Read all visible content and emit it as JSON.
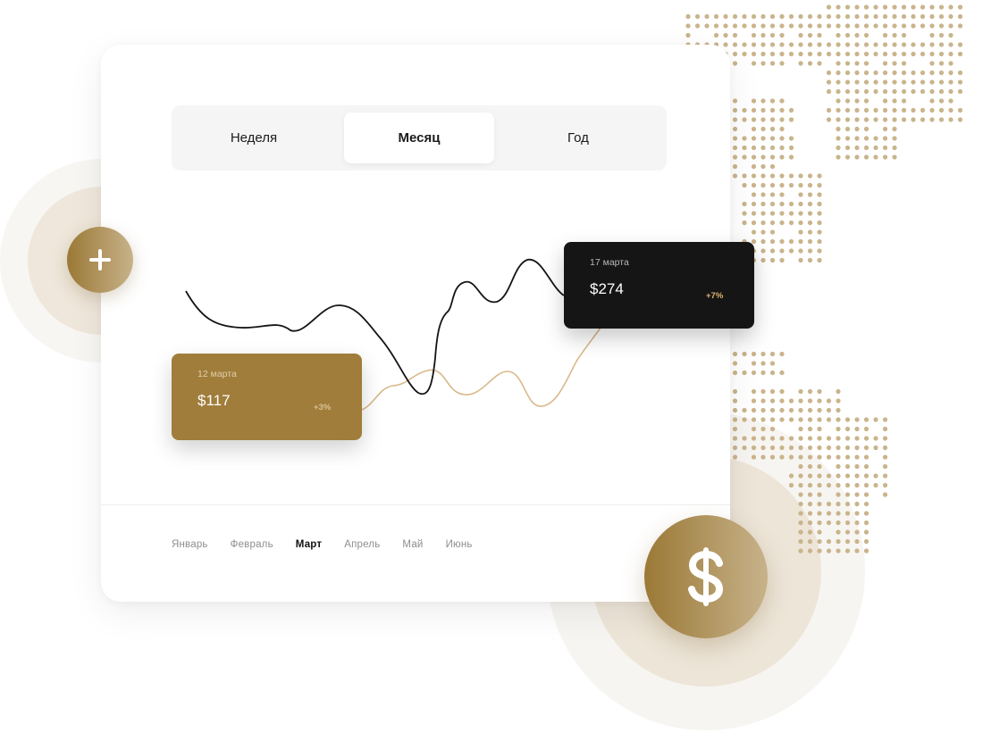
{
  "colors": {
    "gold": "#a07d3b",
    "gold_light": "#d9b98a",
    "dark": "#151515",
    "map_dots": "#c9b48c"
  },
  "period_tabs": [
    {
      "label": "Неделя",
      "active": false
    },
    {
      "label": "Месяц",
      "active": true
    },
    {
      "label": "Год",
      "active": false
    }
  ],
  "months": [
    {
      "label": "Январь",
      "active": false
    },
    {
      "label": "Февраль",
      "active": false
    },
    {
      "label": "Март",
      "active": true
    },
    {
      "label": "Апрель",
      "active": false
    },
    {
      "label": "Май",
      "active": false
    },
    {
      "label": "Июнь",
      "active": false
    }
  ],
  "tooltips": {
    "gold": {
      "date": "12 марта",
      "amount": "$117",
      "change": "+3%"
    },
    "dark": {
      "date": "17 марта",
      "amount": "$274",
      "change": "+7%"
    }
  },
  "icons": {
    "add": "plus-icon",
    "money": "dollar-icon"
  }
}
